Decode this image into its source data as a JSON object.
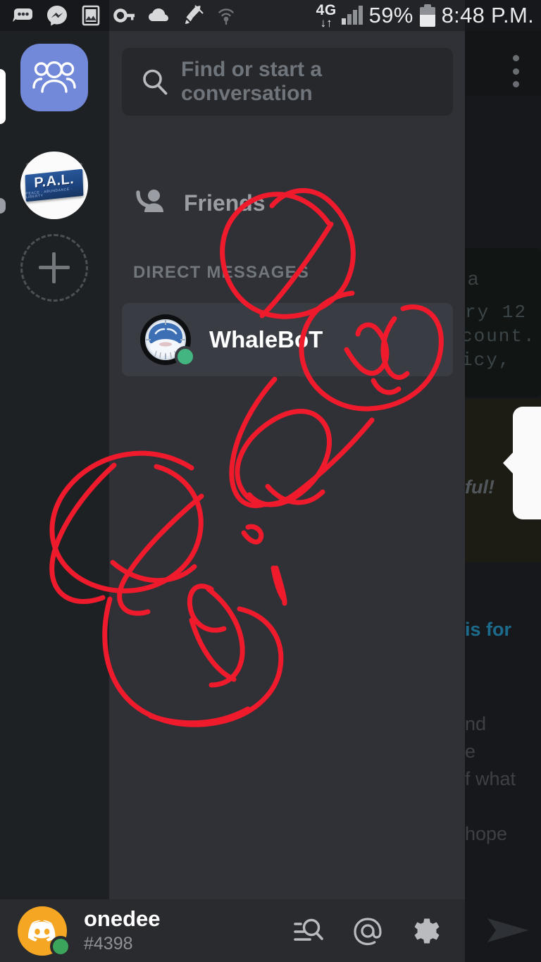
{
  "status_bar": {
    "icons": [
      "chat-dots-icon",
      "messenger-icon",
      "gallery-icon",
      "key-icon",
      "cloud-icon",
      "rocket-icon",
      "hotspot-icon"
    ],
    "network_type": "4G",
    "data_arrows": "↓↑",
    "battery_percent": "59%",
    "time": "8:48 P.M."
  },
  "server_rail": {
    "home_label": "Home",
    "servers": [
      {
        "name": "P.A.L.",
        "logo_text": "P.A.L.",
        "logo_tagline": "PEACE · ABUNDANCE · LIBERTY"
      }
    ],
    "add_server_label": "+"
  },
  "drawer": {
    "search": {
      "placeholder": "Find or start a conversation",
      "value": ""
    },
    "friends_label": "Friends",
    "dm_header": "DIRECT MESSAGES",
    "conversations": [
      {
        "name": "WhaleBoT",
        "status": "online",
        "selected": true
      }
    ]
  },
  "background_chat": {
    "overflow_menu": "⋮",
    "fragments": [
      "a",
      "ry 12",
      "count.",
      "icy,",
      "ful!",
      "is for",
      "nd",
      "e",
      "f what",
      "hope"
    ]
  },
  "bottom_bar": {
    "username": "onedee",
    "discriminator": "#4398",
    "actions": [
      "friend-search-icon",
      "mentions-icon",
      "settings-gear-icon"
    ],
    "send_icon": "send-arrow-icon"
  },
  "annotation": {
    "tool": "freehand-ink",
    "color": "#ef1b2d",
    "stroke_width": 7
  },
  "colors": {
    "drawer_bg": "#2f3136",
    "rail_bg": "#1e2124",
    "bottom_bar_bg": "#292b2f",
    "selected_row": "#393c43",
    "accent_blurple": "#7289da",
    "online_green": "#43b581",
    "ink_red": "#ef1b2d"
  }
}
